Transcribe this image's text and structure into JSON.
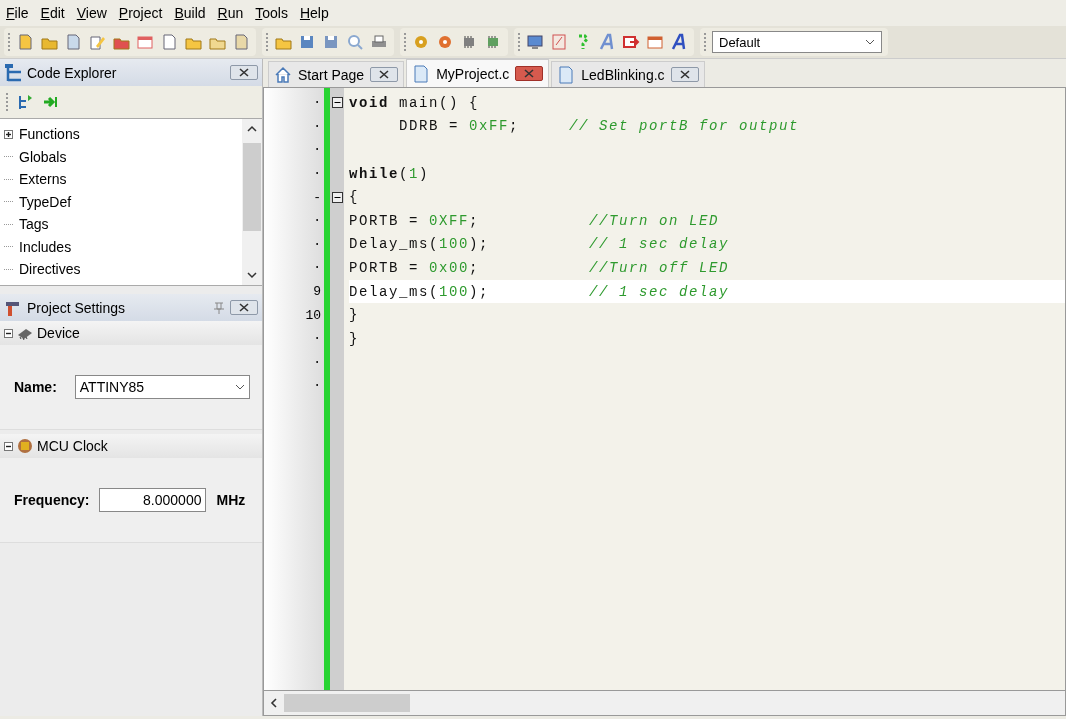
{
  "menu": [
    "File",
    "Edit",
    "View",
    "Project",
    "Build",
    "Run",
    "Tools",
    "Help"
  ],
  "toolbar": {
    "configuration": "Default"
  },
  "code_explorer": {
    "title": "Code Explorer",
    "tree": [
      {
        "label": "Functions",
        "kind": "group",
        "expanded": false
      },
      {
        "label": "Globals",
        "kind": "leaf"
      },
      {
        "label": "Externs",
        "kind": "leaf"
      },
      {
        "label": "TypeDef",
        "kind": "leaf"
      },
      {
        "label": "Tags",
        "kind": "leaf"
      },
      {
        "label": "Includes",
        "kind": "leaf"
      },
      {
        "label": "Directives",
        "kind": "leaf"
      }
    ]
  },
  "project_settings": {
    "title": "Project Settings",
    "sections": [
      {
        "title": "Device",
        "kind": "device",
        "expanded": true,
        "field_label": "Name:",
        "value": "ATTINY85"
      },
      {
        "title": "MCU Clock",
        "kind": "clock",
        "expanded": true,
        "field_label": "Frequency:",
        "value": "8.000000",
        "unit": "MHz"
      }
    ]
  },
  "tabs": [
    {
      "label": "Start Page",
      "kind": "home",
      "selected": false
    },
    {
      "label": "MyProject.c",
      "kind": "file",
      "selected": true
    },
    {
      "label": "LedBlinking.c",
      "kind": "file",
      "selected": false
    }
  ],
  "editor": {
    "lines": [
      {
        "gutter": "·",
        "fold_toggle": true,
        "current": false,
        "segments": [
          {
            "kind": "keyword",
            "text": "void"
          },
          {
            "kind": "text",
            "text": " main() {"
          }
        ]
      },
      {
        "gutter": "·",
        "fold_toggle": false,
        "current": false,
        "segments": [
          {
            "kind": "text",
            "text": "     DDRB = "
          },
          {
            "kind": "number",
            "text": "0xFF"
          },
          {
            "kind": "text",
            "text": ";     "
          },
          {
            "kind": "comment",
            "text": "// Set portB for output"
          }
        ]
      },
      {
        "gutter": "·",
        "fold_toggle": false,
        "current": false
      },
      {
        "gutter": "·",
        "fold_toggle": false,
        "current": false,
        "segments": [
          {
            "kind": "keyword",
            "text": "while"
          },
          {
            "kind": "text",
            "text": "("
          },
          {
            "kind": "number",
            "text": "1"
          },
          {
            "kind": "text",
            "text": ")"
          }
        ]
      },
      {
        "gutter": "-",
        "fold_toggle": true,
        "current": false,
        "segments": [
          {
            "kind": "text",
            "text": "{"
          }
        ]
      },
      {
        "gutter": "·",
        "fold_toggle": false,
        "current": false,
        "segments": [
          {
            "kind": "text",
            "text": "PORTB = "
          },
          {
            "kind": "number",
            "text": "0XFF"
          },
          {
            "kind": "text",
            "text": ";           "
          },
          {
            "kind": "comment",
            "text": "//Turn on LED"
          }
        ]
      },
      {
        "gutter": "·",
        "fold_toggle": false,
        "current": false,
        "segments": [
          {
            "kind": "text",
            "text": "Delay_ms("
          },
          {
            "kind": "number",
            "text": "100"
          },
          {
            "kind": "text",
            "text": ");          "
          },
          {
            "kind": "comment",
            "text": "// 1 sec delay"
          }
        ]
      },
      {
        "gutter": "·",
        "fold_toggle": false,
        "current": false,
        "segments": [
          {
            "kind": "text",
            "text": "PORTB = "
          },
          {
            "kind": "number",
            "text": "0x00"
          },
          {
            "kind": "text",
            "text": ";           "
          },
          {
            "kind": "comment",
            "text": "//Turn off LED"
          }
        ]
      },
      {
        "gutter": "9",
        "fold_toggle": false,
        "current": true,
        "segments": [
          {
            "kind": "text",
            "text": "Delay_ms("
          },
          {
            "kind": "number",
            "text": "100"
          },
          {
            "kind": "text",
            "text": ");          "
          },
          {
            "kind": "comment",
            "text": "// 1 sec delay"
          }
        ]
      },
      {
        "gutter": "10",
        "fold_toggle": false,
        "current": false,
        "segments": [
          {
            "kind": "text",
            "text": "}"
          }
        ]
      },
      {
        "gutter": "·",
        "fold_toggle": false,
        "current": false,
        "segments": [
          {
            "kind": "text",
            "text": "}"
          }
        ]
      },
      {
        "gutter": "·",
        "fold_toggle": false,
        "current": false
      },
      {
        "gutter": "·",
        "fold_toggle": false,
        "current": false
      }
    ]
  }
}
